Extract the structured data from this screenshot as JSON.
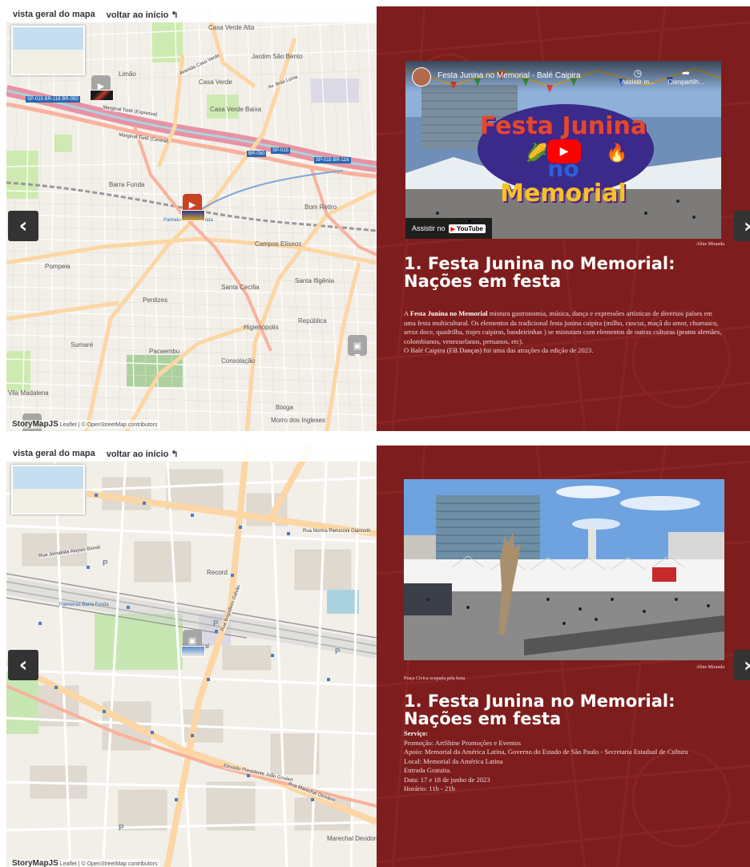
{
  "panels": [
    {
      "nav": {
        "overview": "vista geral do mapa",
        "home": "voltar ao início ↰"
      },
      "prev": "‹",
      "next": "›",
      "attribution": {
        "brand": "StoryMapJS",
        "text": "Leaflet | © OpenStreetMap contributors"
      },
      "map_labels": [
        "Casa Verde Alta",
        "Jardim São Bento",
        "Casa Verde",
        "Limão",
        "Casa Verde Baixa",
        "Barra Funda",
        "Bom Retiro",
        "Campos Elíseos",
        "Pompeia",
        "Perdizes",
        "Santa Cecília",
        "Santa Ifigênia",
        "Higienópolis",
        "República",
        "Sumaré",
        "Pacaembu",
        "Consolação",
        "Vila Madalena",
        "Bixiga",
        "Morro dos Ingleses",
        "Palmeiras Barra Funda",
        "Metrô da Barra Funda"
      ],
      "road_labels": [
        "Marginal Tietê (Expressa)",
        "Marginal Tietê (Central)",
        "Avenida Casa Verde",
        "Av. Brás Leme",
        "Rua Cônego"
      ],
      "shields": [
        "SP-015 BR-116 BR-050",
        "BR-050",
        "SP-015",
        "SP-015 BR-116"
      ],
      "video": {
        "channel_title": "Festa Junina no Memorial - Balé Caipira",
        "watch_later": "Assistir m...",
        "share": "Compartilh...",
        "overlay_line1": "Festa Junina",
        "overlay_line2": "no",
        "overlay_line3": "Memorial",
        "watch_on": "Assistir no",
        "youtube": "YouTube"
      },
      "credit": "Aline Miranda",
      "title": "1. Festa Junina no Memorial: Nações em festa",
      "body": {
        "pre": "A ",
        "bold": "Festa Junina no Memorial",
        "text": " mistura gastronomia, música, dança e expressões artísticas de diversos países em uma festa multicultural. Os elementos da tradicional festa junina caipira (milho, cuscuz, maçã do amor, churrasco, arroz doce, quadrilha, trajes caipiras, bandeirinhas ) se misturam com elementos de outras culturas (pratos alemães, colombianos, venezuelanos, peruanos, etc).",
        "extra": "O Balé Caipira (FB Danças) foi uma das atrações da edição de 2023."
      }
    },
    {
      "nav": {
        "overview": "vista geral do mapa",
        "home": "voltar ao início ↰"
      },
      "prev": "‹",
      "next": "›",
      "attribution": {
        "brand": "StoryMapJS",
        "text": "Leaflet | © OpenStreetMap contributors"
      },
      "map_labels": [
        "Record",
        "Memorial",
        "Palmeiras Barra Funda",
        "Marechal Deodoro"
      ],
      "road_labels": [
        "Rua Norma Pieruccini Giannotti",
        "Rua Jornalista Aloysio Biondi",
        "Elevado Presidente João Goulart",
        "Rua Marechal Deodoro",
        "Rua Brigadeiro Galvão"
      ],
      "photo_caption": "Praça Cívica ocupada pela festa",
      "credit": "Aline Miranda",
      "title": "1. Festa Junina no Memorial: Nações em festa",
      "service": {
        "heading": "Serviço:",
        "lines": [
          "Promoção: ArtShine Promoções e Eventos",
          "Apoio: Memorial da América Latina, Governo do Estado de São Paulo - Secretaria Estadual de Cultura",
          "Local: Memorial da América Latina",
          "Entrada Gratuita.",
          "Data: 17 e 18 de junho de 2023",
          "Horário: 11h - 21h"
        ]
      }
    }
  ],
  "colors": {
    "story_bg": "#7e1d1d",
    "marker_active": "#c8431f",
    "map_bg": "#f2efe9",
    "highway": "#e892a2",
    "primary_road": "#fcd6a4"
  },
  "icons": [
    "chevron-left-icon",
    "chevron-right-icon",
    "video-marker-icon",
    "image-marker-icon",
    "play-icon",
    "clock-icon",
    "share-icon"
  ]
}
